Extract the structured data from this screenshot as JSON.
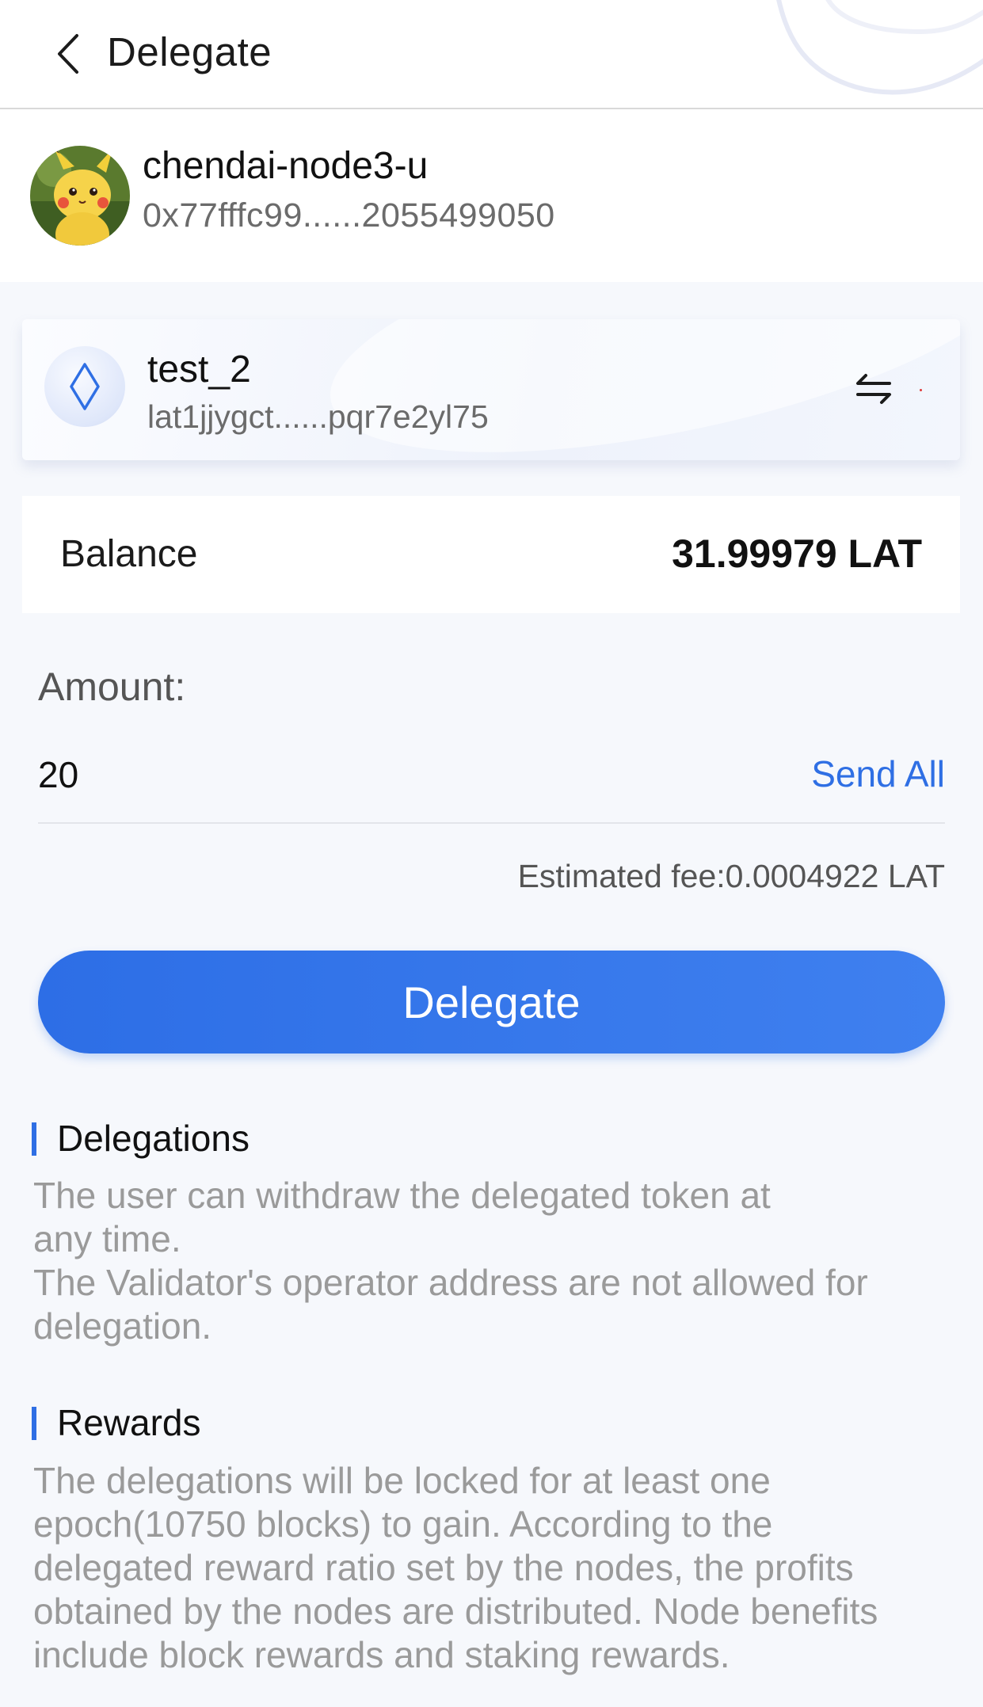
{
  "header": {
    "title": "Delegate"
  },
  "validator": {
    "name": "chendai-node3-u",
    "address": "0x77fffc99......2055499050"
  },
  "wallet": {
    "name": "test_2",
    "address": "lat1jjygct......pqr7e2yl75"
  },
  "balance": {
    "label": "Balance",
    "value": "31.99979 LAT"
  },
  "amount": {
    "label": "Amount:",
    "value": "20",
    "send_all_label": "Send All",
    "estimated_fee": "Estimated fee:0.0004922 LAT"
  },
  "delegate_button": {
    "label": "Delegate"
  },
  "sections": {
    "delegations": {
      "title": "Delegations",
      "line1": "The user can withdraw the delegated token at",
      "line2": "any time.",
      "line3": "The Validator's operator address are not allowed for",
      "line4": "delegation."
    },
    "rewards": {
      "title": "Rewards",
      "line1": "The delegations will be locked for at least one",
      "line2": "epoch(10750 blocks) to gain. According to the",
      "line3": "delegated reward ratio set by the nodes, the profits",
      "line4": "obtained by the nodes are distributed. Node benefits",
      "line5": "include block rewards and staking rewards."
    }
  },
  "icons": {
    "back": "chevron-left-icon",
    "wallet": "diamond-icon",
    "switch": "switch-arrows-icon",
    "avatar": "pikachu-avatar"
  },
  "colors": {
    "accent": "#2f6fe4",
    "page_background": "#f6f8fc",
    "secondary_text": "#9a9a9a"
  }
}
